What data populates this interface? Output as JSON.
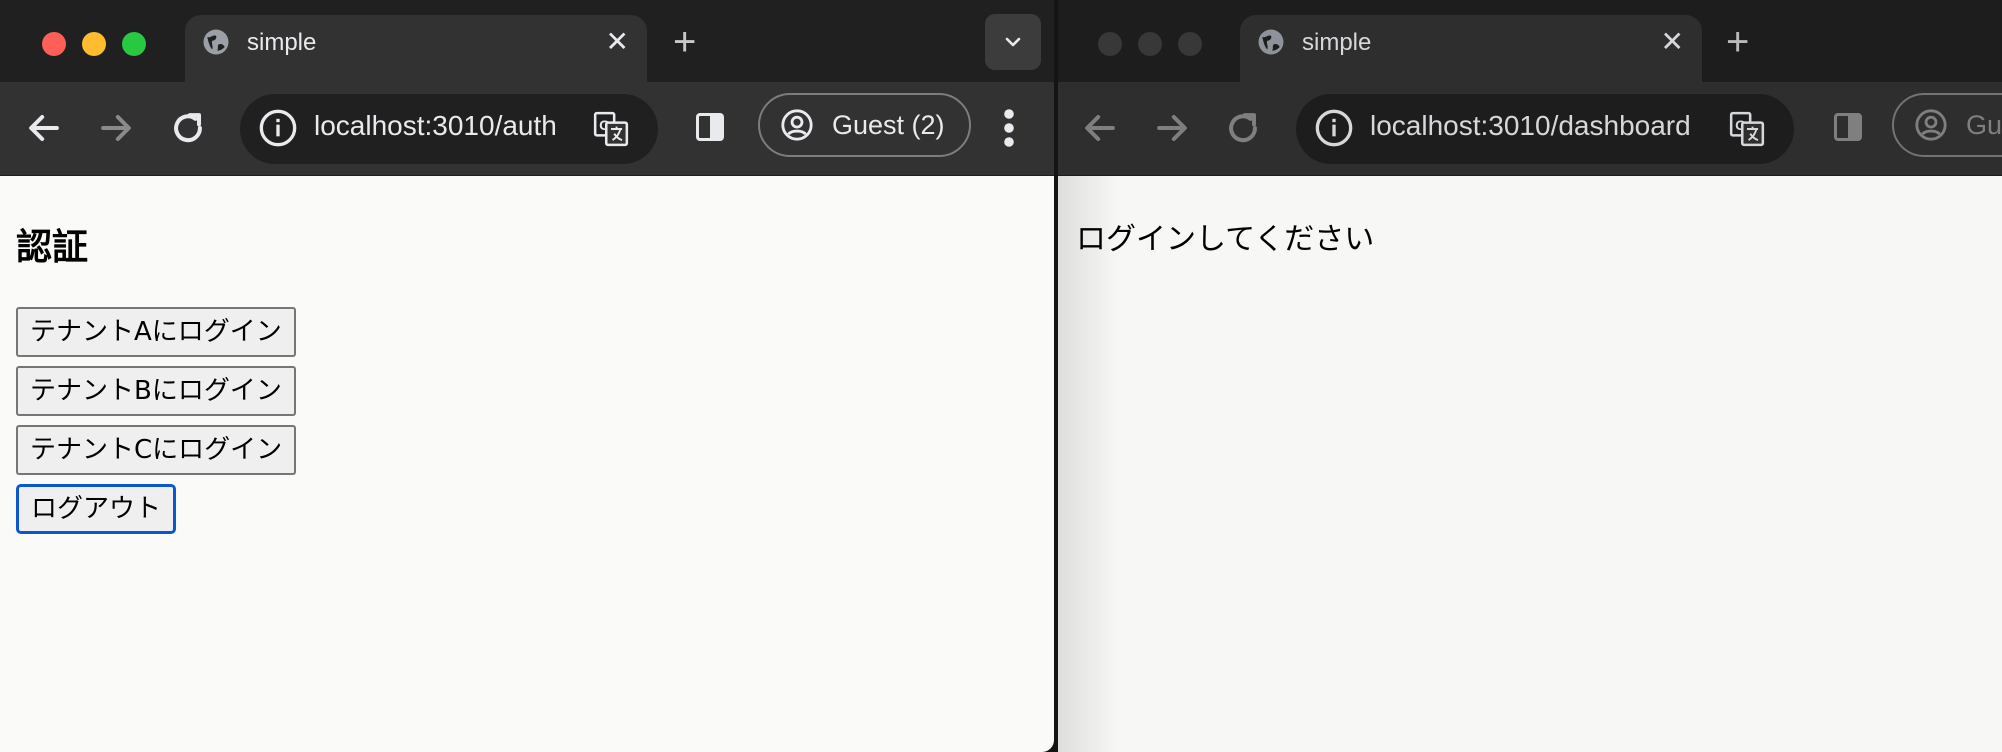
{
  "left_window": {
    "tab": {
      "title": "simple",
      "close_icon": "close-icon",
      "favicon": "globe-icon"
    },
    "new_tab_label": "+",
    "url": "localhost:3010/auth",
    "profile_label": "Guest (2)",
    "page": {
      "heading": "認証",
      "buttons": [
        "テナントAにログイン",
        "テナントBにログイン",
        "テナントCにログイン",
        "ログアウト"
      ]
    }
  },
  "right_window": {
    "tab": {
      "title": "simple",
      "close_icon": "close-icon",
      "favicon": "globe-icon"
    },
    "new_tab_label": "+",
    "url": "localhost:3010/dashboard",
    "profile_label": "Gu",
    "page": {
      "message": "ログインしてください"
    }
  },
  "colors": {
    "close": "#fe5f57",
    "minimize": "#febc2e",
    "zoom": "#28c840",
    "focus_ring": "#0b57d0",
    "page_bg": "#fafaf8"
  }
}
